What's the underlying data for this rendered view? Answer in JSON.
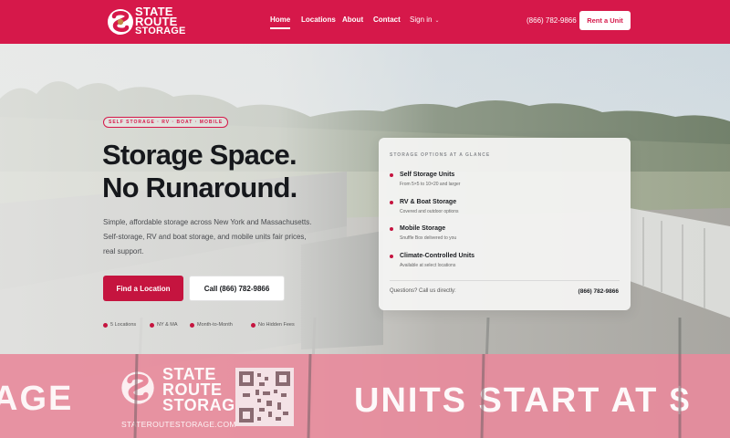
{
  "brand": {
    "name_line1": "STATE",
    "name_line2": "ROUTE",
    "name_line3": "STORAGE",
    "primary_color": "#d6184a",
    "logo_icon": "sr-monogram-icon"
  },
  "nav": {
    "items": [
      "Home",
      "Locations",
      "About",
      "Contact",
      "Sign in"
    ],
    "active": "Home",
    "signin_icon": "chevron-down-icon"
  },
  "header": {
    "phone": "(866) 782-9866",
    "rent_label": "Rent a Unit"
  },
  "hero": {
    "badge": "SELF STORAGE · RV · BOAT · MOBILE",
    "headline_line1": "Storage Space.",
    "headline_line2": "No Runaround.",
    "subtext_line1": "Simple, affordable storage across New York and Massachusetts.",
    "subtext_line2": "Self-storage, RV and boat storage, and mobile units fair prices,",
    "subtext_line3": "real support.",
    "primary_cta": "Find a Location",
    "secondary_cta": "Call (866) 782-9866",
    "features": [
      "5 Locations",
      "NY & MA",
      "Month-to-Month",
      "No Hidden Fees"
    ]
  },
  "glance": {
    "title": "STORAGE OPTIONS AT A GLANCE",
    "options": [
      {
        "name": "Self Storage Units",
        "desc": "From 5×5 to 10×20 and larger"
      },
      {
        "name": "RV & Boat Storage",
        "desc": "Covered and outdoor options"
      },
      {
        "name": "Mobile Storage",
        "desc": "Snuffle Box delivered to you"
      },
      {
        "name": "Climate-Controlled Units",
        "desc": "Available at select locations"
      }
    ],
    "question": "Questions? Call us directly:",
    "phone": "(866) 782-9866"
  },
  "banner": {
    "left_text": "AGE",
    "logo_line1": "STATE",
    "logo_line2": "ROUTE",
    "logo_line3": "STORAGE",
    "url": "STATEROUTESTORAGE.COM",
    "right_text": "UNITS START AT $",
    "qr_icon": "qr-code-icon"
  }
}
